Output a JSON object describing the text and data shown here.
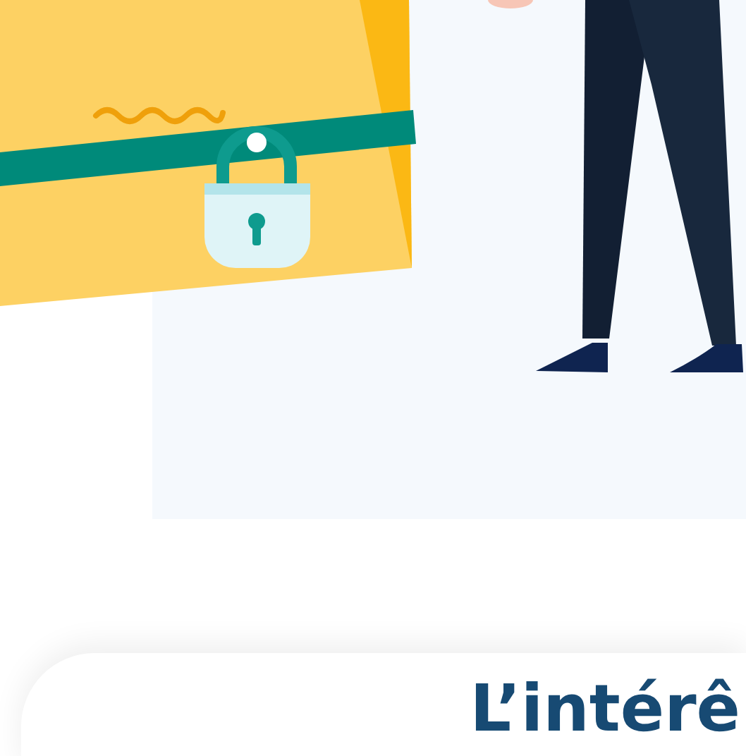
{
  "feature_card": {
    "heading": "L’intérê"
  }
}
